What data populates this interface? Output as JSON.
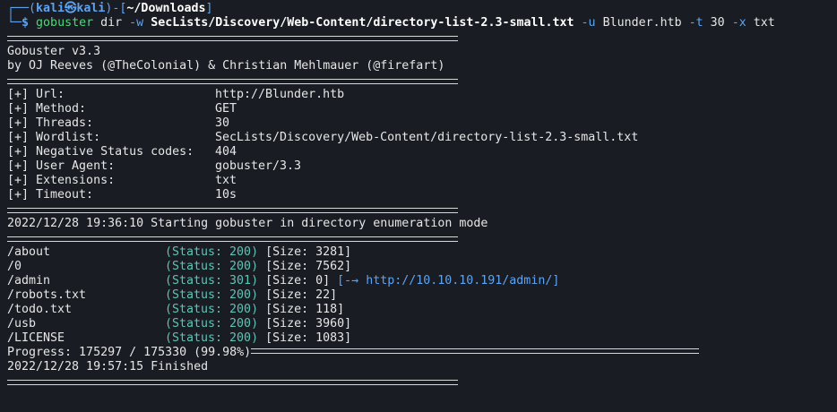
{
  "prompt": {
    "user": "kali",
    "host": "kali",
    "cwd": "~/Downloads",
    "symbol": "$",
    "top_prefix": "┌──(",
    "at_icon": "㉿",
    "top_mid": ")-[",
    "top_end": "]",
    "bot_prefix": "└─"
  },
  "command": {
    "binary": "gobuster",
    "mode": "dir",
    "flag_w": "-w",
    "wordlist": "SecLists/Discovery/Web-Content/directory-list-2.3-small.txt",
    "flag_u": "-u",
    "url": "Blunder.htb",
    "flag_t": "-t",
    "threads": "30",
    "flag_x": "-x",
    "ext": "txt"
  },
  "banner": {
    "title": "Gobuster v3.3",
    "authors": "by OJ Reeves (@TheColonial) & Christian Mehlmauer (@firefart)"
  },
  "config": [
    {
      "key": "[+] Url:",
      "value": "http://Blunder.htb"
    },
    {
      "key": "[+] Method:",
      "value": "GET"
    },
    {
      "key": "[+] Threads:",
      "value": "30"
    },
    {
      "key": "[+] Wordlist:",
      "value": "SecLists/Discovery/Web-Content/directory-list-2.3-small.txt"
    },
    {
      "key": "[+] Negative Status codes:",
      "value": "404"
    },
    {
      "key": "[+] User Agent:",
      "value": "gobuster/3.3"
    },
    {
      "key": "[+] Extensions:",
      "value": "txt"
    },
    {
      "key": "[+] Timeout:",
      "value": "10s"
    }
  ],
  "start_line": "2022/12/28 19:36:10 Starting gobuster in directory enumeration mode",
  "results": [
    {
      "path": "/about",
      "status": "(Status: 200)",
      "size": "[Size: 3281]",
      "redirect": ""
    },
    {
      "path": "/0",
      "status": "(Status: 200)",
      "size": "[Size: 7562]",
      "redirect": ""
    },
    {
      "path": "/admin",
      "status": "(Status: 301)",
      "size": "[Size: 0]",
      "redirect": "[-→ http://10.10.10.191/admin/]"
    },
    {
      "path": "/robots.txt",
      "status": "(Status: 200)",
      "size": "[Size: 22]",
      "redirect": ""
    },
    {
      "path": "/todo.txt",
      "status": "(Status: 200)",
      "size": "[Size: 118]",
      "redirect": ""
    },
    {
      "path": "/usb",
      "status": "(Status: 200)",
      "size": "[Size: 3960]",
      "redirect": ""
    },
    {
      "path": "/LICENSE",
      "status": "(Status: 200)",
      "size": "[Size: 1083]",
      "redirect": ""
    }
  ],
  "progress": "Progress: 175297 / 175330 (99.98%)",
  "finished_line": "2022/12/28 19:57:15 Finished",
  "colors": {
    "background": "#1a1c23",
    "prompt_blue": "#5ea3f0",
    "command_green": "#4fd67a",
    "status_teal": "#5ec4b6"
  }
}
